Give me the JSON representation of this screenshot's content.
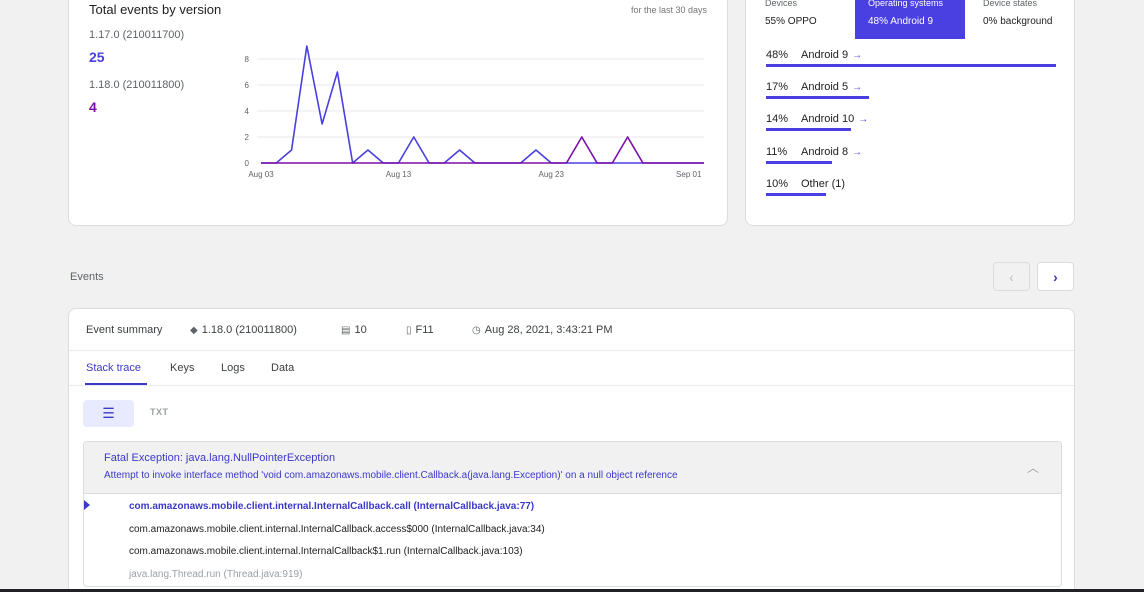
{
  "chart_card": {
    "title": "Total events by version",
    "range_label": "for the last 30 days",
    "versions": [
      {
        "name": "1.17.0 (210011700)",
        "count": "25",
        "color": "#4a3fe0"
      },
      {
        "name": "1.18.0 (210011800)",
        "count": "4",
        "color": "#7b0fa8"
      }
    ]
  },
  "chart_data": {
    "type": "line",
    "x_labels": [
      "Aug 03",
      "Aug 13",
      "Aug 23",
      "Sep 01"
    ],
    "y_ticks": [
      0,
      2,
      4,
      6,
      8
    ],
    "ylim": [
      0,
      9
    ],
    "x": [
      1,
      2,
      3,
      4,
      5,
      6,
      7,
      8,
      9,
      10,
      11,
      12,
      13,
      14,
      15,
      16,
      17,
      18,
      19,
      20,
      21,
      22,
      23,
      24,
      25,
      26,
      27,
      28,
      29,
      30
    ],
    "series": [
      {
        "name": "1.17.0 (210011700)",
        "color": "#4a3fe0",
        "values": [
          0,
          0,
          1,
          9,
          3,
          7,
          0,
          1,
          0,
          0,
          2,
          0,
          0,
          1,
          0,
          0,
          0,
          0,
          1,
          0,
          0,
          0,
          0,
          0,
          0,
          0,
          0,
          0,
          0,
          0
        ]
      },
      {
        "name": "1.18.0 (210011800)",
        "color": "#7b0fa8",
        "values": [
          0,
          0,
          0,
          0,
          0,
          0,
          0,
          0,
          0,
          0,
          0,
          0,
          0,
          0,
          0,
          0,
          0,
          0,
          0,
          0,
          0,
          2,
          0,
          0,
          2,
          0,
          0,
          0,
          0,
          0
        ]
      }
    ]
  },
  "os_card": {
    "tabs": [
      {
        "label": "Devices",
        "value": "55% OPPO"
      },
      {
        "label": "Operating systems",
        "value": "48% Android 9"
      },
      {
        "label": "Device states",
        "value": "0% background"
      }
    ],
    "rows": [
      {
        "pct": "48%",
        "name": "Android 9",
        "arrow": "→",
        "share": 0.48
      },
      {
        "pct": "17%",
        "name": "Android 5",
        "arrow": "→",
        "share": 0.17
      },
      {
        "pct": "14%",
        "name": "Android 10",
        "arrow": "→",
        "share": 0.14
      },
      {
        "pct": "11%",
        "name": "Android 8",
        "arrow": "→",
        "share": 0.11
      },
      {
        "pct": "10%",
        "name": "Other (1)",
        "arrow": "",
        "share": 0.1
      }
    ]
  },
  "events": {
    "label": "Events",
    "prev_icon": "chevron-left-icon",
    "next_icon": "chevron-right-icon",
    "prev_glyph": "‹",
    "next_glyph": "›"
  },
  "summary": {
    "title": "Event summary",
    "version": "1.18.0 (210011800)",
    "count": "10",
    "device": "F11",
    "timestamp": "Aug 28, 2021, 3:43:21 PM"
  },
  "tabs": [
    "Stack trace",
    "Keys",
    "Logs",
    "Data"
  ],
  "view": {
    "list_glyph": "☰",
    "txt_label": "TXT"
  },
  "trace": {
    "exception": "Fatal Exception: java.lang.NullPointerException",
    "message": "Attempt to invoke interface method 'void com.amazonaws.mobile.client.Callback.a(java.lang.Exception)' on a null object reference",
    "collapse_glyph": "︿",
    "frames": [
      "com.amazonaws.mobile.client.internal.InternalCallback.call (InternalCallback.java:77)",
      "com.amazonaws.mobile.client.internal.InternalCallback.access$000 (InternalCallback.java:34)",
      "com.amazonaws.mobile.client.internal.InternalCallback$1.run (InternalCallback.java:103)",
      "java.lang.Thread.run (Thread.java:919)"
    ]
  }
}
